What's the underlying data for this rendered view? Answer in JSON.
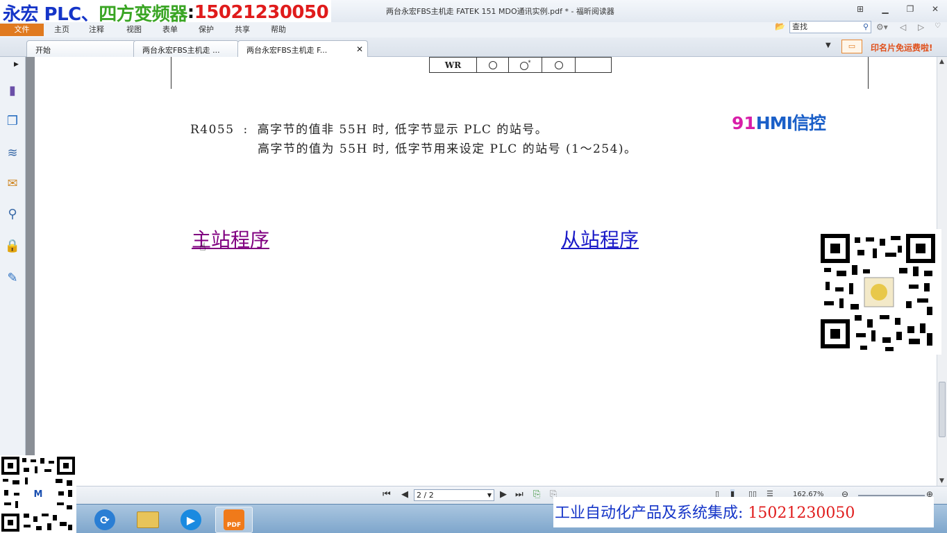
{
  "window": {
    "title": "两台永宏FBS主机走 FATEK 151 MDO通讯实例.pdf * - 福昕阅读器"
  },
  "watermark": {
    "brand_blue": "永宏 PLC、",
    "brand_green": "四方变频器",
    "colon": ":",
    "phone": "15021230050",
    "bottom_text": "工业自动化产品及系统集成:",
    "bottom_phone": "15021230050",
    "colors": {
      "blue": "#1535c8",
      "green": "#3aa524",
      "red": "#e01b1b"
    }
  },
  "ribbon": {
    "tabs": [
      "文件",
      "主页",
      "注释",
      "视图",
      "表单",
      "保护",
      "共享",
      "帮助"
    ],
    "search_value": "查找"
  },
  "doc_tabs": {
    "tabs": [
      {
        "label": "开始"
      },
      {
        "label": "两台永宏FBS主机走 ..."
      },
      {
        "label": "两台永宏FBS主机走 F..."
      }
    ],
    "ad_text": "印名片免运费啦!"
  },
  "document": {
    "table_row": {
      "label": "WR",
      "cells": [
        "circle",
        "circle-star",
        "circle",
        ""
      ]
    },
    "r4055": {
      "label": "R4055",
      "sep": ":",
      "line1": "高字节的值非 55H 时, 低字节显示 PLC 的站号。",
      "line2": "高字节的值为 55H 时, 低字节用来设定 PLC 的站号 (1～254)。"
    },
    "logo": {
      "num": "91",
      "hmi": "HMI",
      "cn": "信控"
    },
    "links": {
      "master": "主站程序",
      "slave": "从站程序"
    },
    "link_colors": {
      "visited": "#800080",
      "normal": "#1a1ac8"
    }
  },
  "statusbar": {
    "page_value": "2 / 2",
    "zoom": "162.67%"
  },
  "taskbar": {
    "apps": [
      "browser-icon",
      "folder-icon",
      "media-player-icon",
      "pdf-reader-icon"
    ],
    "active_app_label": "PDF"
  }
}
